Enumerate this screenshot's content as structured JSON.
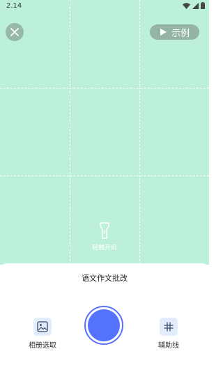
{
  "status_bar": {
    "time": "2.14"
  },
  "camera": {
    "example_label": "示例",
    "flash_label": "轻触开启"
  },
  "sheet": {
    "mode_title": "语文作文批改",
    "album_label": "相册选取",
    "guides_label": "辅助线"
  },
  "colors": {
    "camera_bg": "#bdf0d9",
    "shutter": "#5572ff",
    "icon_tile": "#e3ecfa"
  }
}
